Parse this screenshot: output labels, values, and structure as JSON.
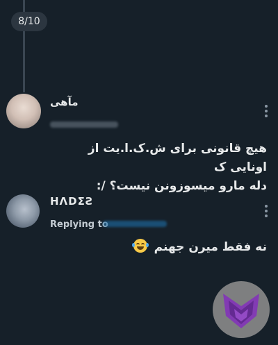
{
  "viewer": {
    "counter": "8/10"
  },
  "tweet": {
    "author_name": "مآهی",
    "avatar_icon": "user-avatar",
    "lines": [
      "هیچ قانونی برای ش.ک.ا.یت از اونایی ک",
      "دله مارو میسوزونن نیست؟ /:"
    ]
  },
  "reply": {
    "author_name": "HΛDΣƧ",
    "avatar_icon": "user-avatar",
    "replying_label": "Replying to",
    "text": "نه فقط میرن جهنم",
    "emoji_icon": "face-with-tears-of-joy-icon"
  },
  "fab": {
    "icon": "purple-fox-logo-icon",
    "colors": {
      "background": "#8a8a8a",
      "logo": "#8e3fc2"
    }
  },
  "colors": {
    "background": "#162029",
    "text": "#e7e9ea",
    "muted": "#8b98a5"
  }
}
